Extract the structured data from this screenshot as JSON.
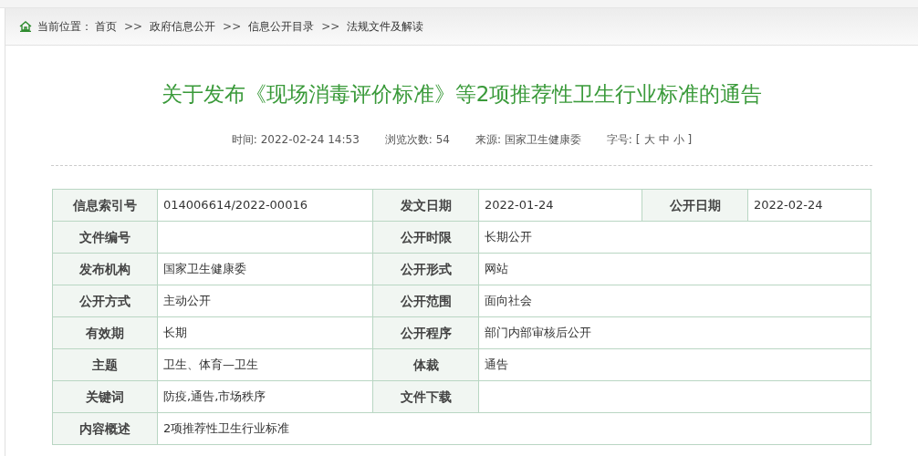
{
  "breadcrumb": {
    "label": "当前位置：",
    "items": [
      {
        "kind": "link",
        "text": "首页"
      },
      {
        "kind": "separator",
        "text": ">>"
      },
      {
        "kind": "link",
        "text": "政府信息公开"
      },
      {
        "kind": "separator",
        "text": ">>"
      },
      {
        "kind": "link",
        "text": "信息公开目录"
      },
      {
        "kind": "separator",
        "text": ">>"
      },
      {
        "kind": "link",
        "text": "法规文件及解读"
      }
    ]
  },
  "title": "关于发布《现场消毒评价标准》等2项推荐性卫生行业标准的通告",
  "meta": [
    {
      "label": "时间:",
      "value": "2022-02-24 14:53"
    },
    {
      "label": "浏览次数:",
      "value": "54"
    },
    {
      "label": "来源:",
      "value": "国家卫生健康委"
    }
  ],
  "font_size": {
    "label": "字号:",
    "open": "[",
    "options": [
      "大",
      "中",
      "小"
    ],
    "close": "]"
  },
  "table": {
    "rows": [
      [
        {
          "kind": "label",
          "text": "信息索引号"
        },
        {
          "kind": "value",
          "text": "014006614/2022-00016"
        },
        {
          "kind": "label",
          "text": "发文日期"
        },
        {
          "kind": "value",
          "text": "2022-01-24"
        },
        {
          "kind": "label",
          "text": "公开日期"
        },
        {
          "kind": "value",
          "text": "2022-02-24"
        }
      ],
      [
        {
          "kind": "label",
          "text": "文件编号"
        },
        {
          "kind": "value"
        },
        {
          "kind": "label",
          "text": "公开时限"
        },
        {
          "kind": "value",
          "text": "长期公开",
          "colspan": 3
        }
      ],
      [
        {
          "kind": "label",
          "text": "发布机构"
        },
        {
          "kind": "value",
          "text": "国家卫生健康委"
        },
        {
          "kind": "label",
          "text": "公开形式"
        },
        {
          "kind": "value",
          "text": "网站",
          "colspan": 3
        }
      ],
      [
        {
          "kind": "label",
          "text": "公开方式"
        },
        {
          "kind": "value",
          "text": "主动公开"
        },
        {
          "kind": "label",
          "text": "公开范围"
        },
        {
          "kind": "value",
          "text": "面向社会",
          "colspan": 3
        }
      ],
      [
        {
          "kind": "label",
          "text": "有效期"
        },
        {
          "kind": "value",
          "text": "长期"
        },
        {
          "kind": "label",
          "text": "公开程序"
        },
        {
          "kind": "value",
          "text": "部门内部审核后公开",
          "colspan": 3
        }
      ],
      [
        {
          "kind": "label",
          "text": "主题"
        },
        {
          "kind": "value",
          "text": "卫生、体育—卫生"
        },
        {
          "kind": "label",
          "text": "体裁"
        },
        {
          "kind": "value",
          "text": "通告",
          "colspan": 3
        }
      ],
      [
        {
          "kind": "label",
          "text": "关键词"
        },
        {
          "kind": "value",
          "text": "防疫,通告,市场秩序"
        },
        {
          "kind": "label",
          "text": "文件下载"
        },
        {
          "kind": "value",
          "colspan": 3
        }
      ],
      [
        {
          "kind": "label",
          "text": "内容概述"
        },
        {
          "kind": "value",
          "text": "2项推荐性卫生行业标准",
          "colspan": 5
        }
      ]
    ]
  }
}
